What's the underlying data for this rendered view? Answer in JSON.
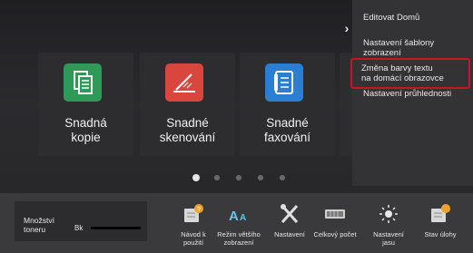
{
  "side_menu": {
    "items": [
      {
        "label": "Editovat Domů"
      },
      {
        "label_line1": "Nastavení šablony",
        "label_line2": "zobrazení"
      },
      {
        "label_line1": "Změna barvy textu",
        "label_line2": "na domácí obrazovce"
      },
      {
        "label": "Nastavení průhlednosti"
      }
    ],
    "toggle_glyph": "›"
  },
  "tiles": [
    {
      "line1": "Snadná",
      "line2": "kopie",
      "icon": "copy-icon",
      "color": "#2f9a58"
    },
    {
      "line1": "Snadné",
      "line2": "skenování",
      "icon": "scan-icon",
      "color": "#d9463e"
    },
    {
      "line1": "Snadné",
      "line2": "faxování",
      "icon": "fax-icon",
      "color": "#2a7fd2"
    }
  ],
  "pager": {
    "pages": 5,
    "active": 1
  },
  "toner": {
    "line1": "Množství",
    "line2": "toneru",
    "channel": "Bk",
    "level_fraction": 1.0
  },
  "bottom_bar": [
    {
      "line1": "Návod k",
      "line2": "použití",
      "icon": "guide-icon"
    },
    {
      "line1": "Režim většího",
      "line2": "zobrazení",
      "icon": "large-text-icon"
    },
    {
      "line1": "Nastavení",
      "line2": "",
      "icon": "tools-icon"
    },
    {
      "line1": "Celkový počet",
      "line2": "",
      "icon": "counter-icon"
    },
    {
      "line1": "Nastavení",
      "line2": "jasu",
      "icon": "brightness-icon"
    },
    {
      "line1": "Stav úlohy",
      "line2": "",
      "icon": "job-status-icon"
    }
  ],
  "colors": {
    "highlight": "#d01028",
    "accent_orange": "#f2a22b"
  }
}
